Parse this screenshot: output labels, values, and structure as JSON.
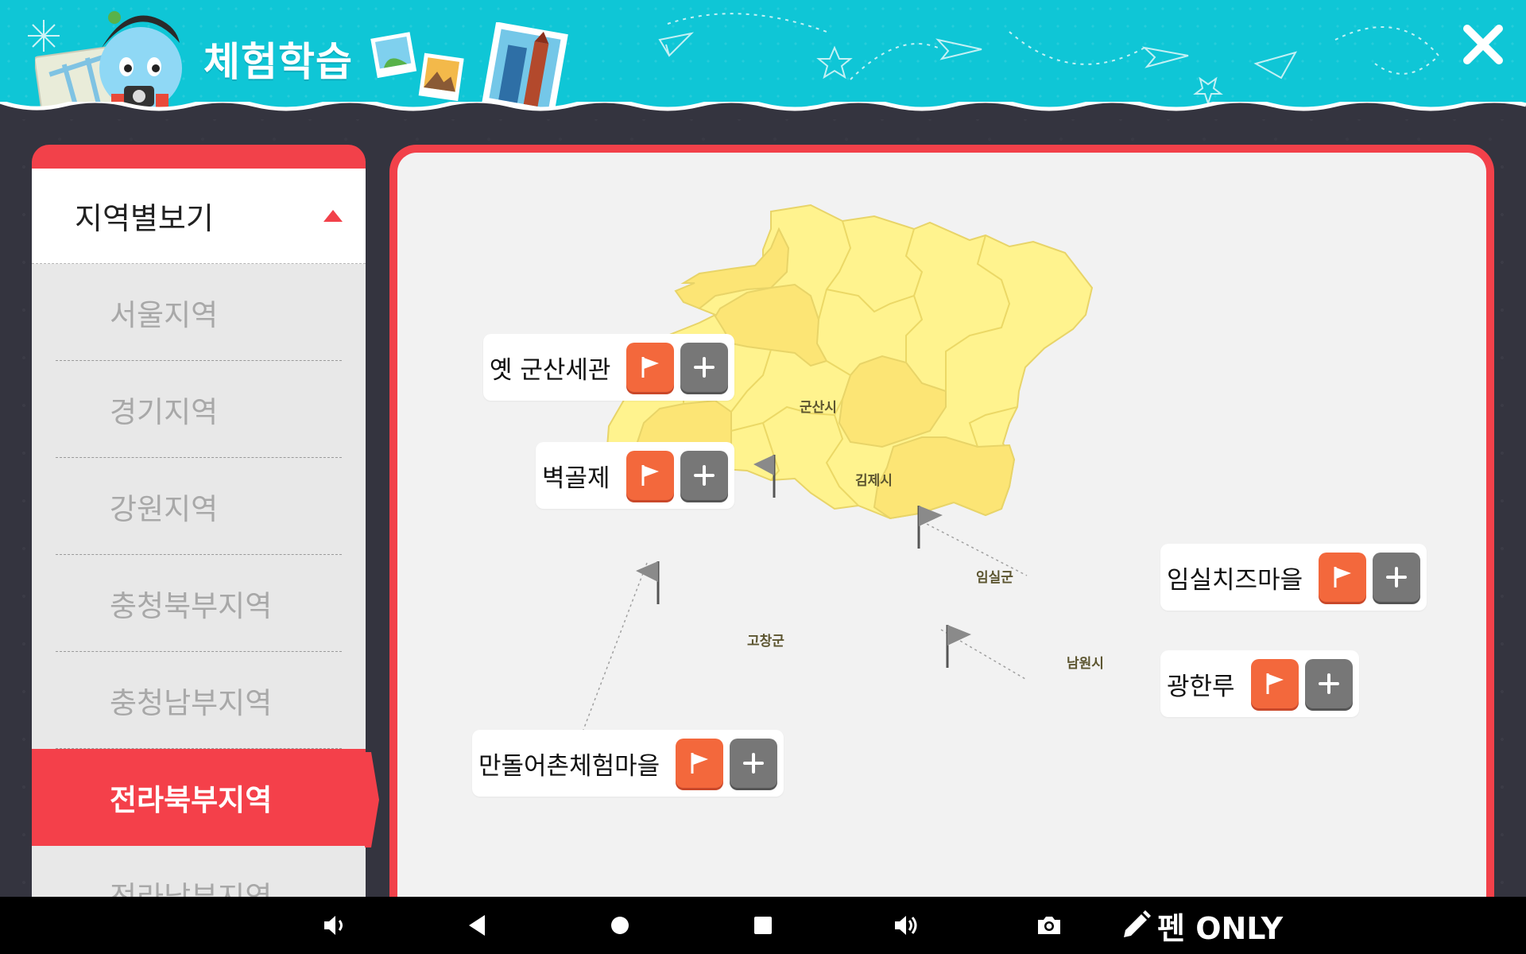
{
  "app": {
    "title": "체험학습",
    "close_icon": "close-icon"
  },
  "sidebar": {
    "header_label": "지역별보기",
    "header_icon": "caret-up-icon",
    "items": [
      {
        "label": "서울지역",
        "active": false
      },
      {
        "label": "경기지역",
        "active": false
      },
      {
        "label": "강원지역",
        "active": false
      },
      {
        "label": "충청북부지역",
        "active": false
      },
      {
        "label": "충청남부지역",
        "active": false
      },
      {
        "label": "전라북부지역",
        "active": true
      },
      {
        "label": "전라남부지역",
        "active": false
      }
    ]
  },
  "map": {
    "regions": [
      "군산시",
      "김제시",
      "임실군",
      "고창군",
      "남원시"
    ],
    "callouts": [
      {
        "label": "옛 군산세관",
        "flag_icon": "flag-icon",
        "plus_icon": "plus-icon"
      },
      {
        "label": "벽골제",
        "flag_icon": "flag-icon",
        "plus_icon": "plus-icon"
      },
      {
        "label": "임실치즈마을",
        "flag_icon": "flag-icon",
        "plus_icon": "plus-icon"
      },
      {
        "label": "광한루",
        "flag_icon": "flag-icon",
        "plus_icon": "plus-icon"
      },
      {
        "label": "만돌어촌체험마을",
        "flag_icon": "flag-icon",
        "plus_icon": "plus-icon"
      }
    ]
  },
  "navbar": {
    "icons": [
      "volume-down-icon",
      "back-icon",
      "home-icon",
      "recents-icon",
      "volume-up-icon",
      "camera-icon",
      "pen-icon"
    ],
    "pen_label": "펜 ONLY"
  },
  "colors": {
    "header": "#0fc6d6",
    "accent_red": "#f2414a",
    "flag_button": "#f3683c",
    "plus_button": "#777777",
    "map_fill": "#fff38e",
    "map_highlight": "#fce575",
    "background": "#34343f"
  }
}
